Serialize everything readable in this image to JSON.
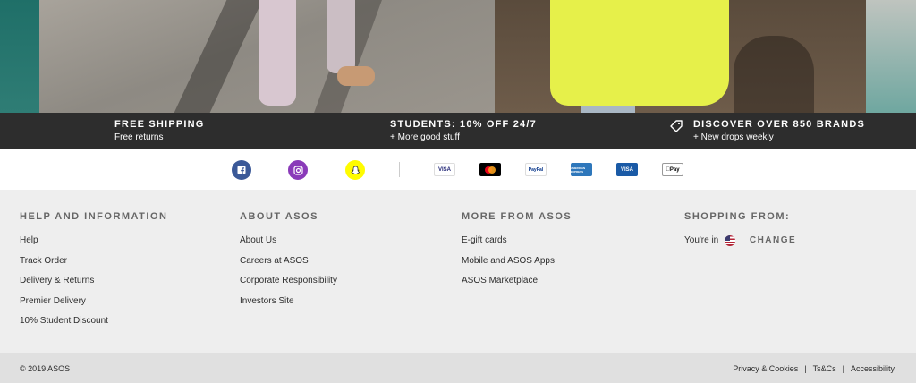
{
  "promo": {
    "items": [
      {
        "title": "FREE SHIPPING",
        "subtitle": "Free returns"
      },
      {
        "title": "STUDENTS: 10% OFF 24/7",
        "subtitle": "+ More good stuff"
      },
      {
        "title": "DISCOVER OVER 850 BRANDS",
        "subtitle": "+ New drops weekly"
      }
    ]
  },
  "social": {
    "icons": [
      "facebook-icon",
      "instagram-icon",
      "snapchat-icon"
    ],
    "colors": {
      "facebook": "#3b5998",
      "instagram": "#8a3ab9",
      "snapchat": "#fffc00"
    }
  },
  "payments": {
    "labels": [
      "VISA",
      "",
      "PayPal",
      "AMERICAN EXPRESS",
      "VISA",
      "Pay"
    ]
  },
  "footer": {
    "help": {
      "title": "HELP AND INFORMATION",
      "links": [
        "Help",
        "Track Order",
        "Delivery & Returns",
        "Premier Delivery",
        "10% Student Discount"
      ]
    },
    "about": {
      "title": "ABOUT ASOS",
      "links": [
        "About Us",
        "Careers at ASOS",
        "Corporate Responsibility",
        "Investors Site"
      ]
    },
    "more": {
      "title": "MORE FROM ASOS",
      "links": [
        "E-gift cards",
        "Mobile and ASOS Apps",
        "ASOS Marketplace"
      ]
    },
    "shopping": {
      "title": "SHOPPING FROM:",
      "youre_in": "You're in",
      "separator": "|",
      "change": "CHANGE"
    }
  },
  "bottom": {
    "copyright": "© 2019 ASOS",
    "legal": [
      "Privacy & Cookies",
      "Ts&Cs",
      "Accessibility"
    ],
    "separator": "|"
  }
}
